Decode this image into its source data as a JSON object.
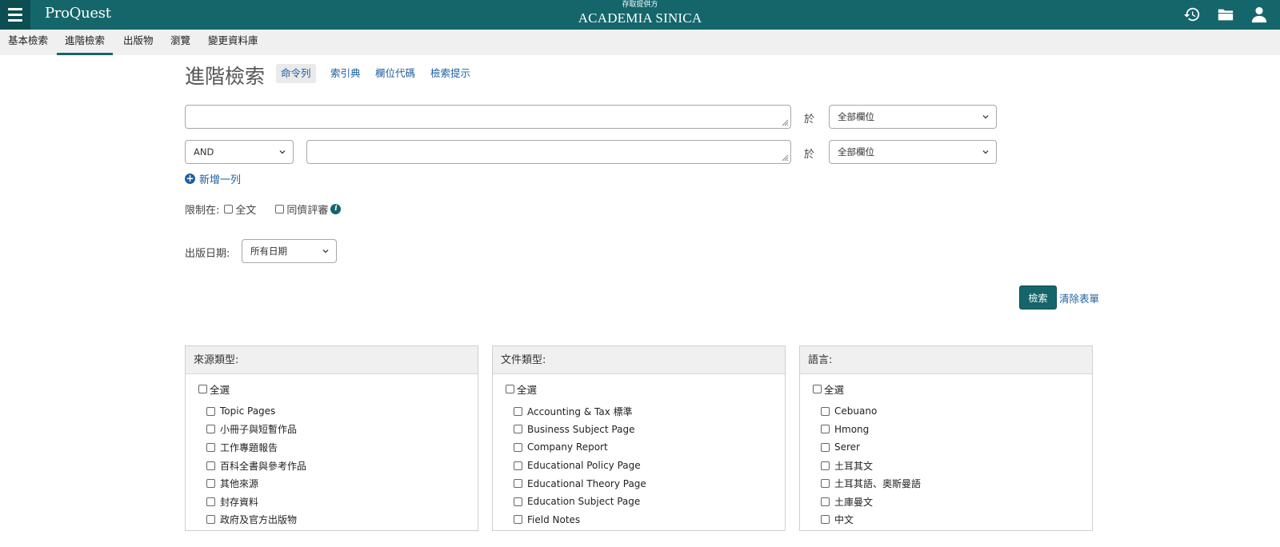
{
  "header": {
    "brand": "ProQuest",
    "provider_label": "存取提供方",
    "institution": "ACADEMIA SINICA",
    "icons": [
      "history-icon",
      "folder-icon",
      "user-icon"
    ],
    "bg_color": "#14666b"
  },
  "nav": {
    "tabs": [
      {
        "label": "基本檢索",
        "active": false
      },
      {
        "label": "進階檢索",
        "active": true
      },
      {
        "label": "出版物",
        "active": false
      },
      {
        "label": "瀏覽",
        "active": false
      },
      {
        "label": "變更資料庫",
        "active": false
      }
    ]
  },
  "title": {
    "text": "進階檢索",
    "links": [
      {
        "label": "命令列",
        "selected": true
      },
      {
        "label": "索引典",
        "selected": false
      },
      {
        "label": "欄位代碼",
        "selected": false
      },
      {
        "label": "檢索提示",
        "selected": false
      }
    ]
  },
  "search_rows": [
    {
      "operator": null,
      "value": "",
      "in_label": "於",
      "field": "全部欄位"
    },
    {
      "operator": "AND",
      "value": "",
      "in_label": "於",
      "field": "全部欄位"
    }
  ],
  "add_row_label": "新增一列",
  "limits": {
    "label": "限制在:",
    "options": [
      {
        "label": "全文",
        "checked": false
      },
      {
        "label": "同儕評審",
        "checked": false
      }
    ]
  },
  "date": {
    "label": "出版日期:",
    "value": "所有日期"
  },
  "actions": {
    "search_label": "檢索",
    "clear_label": "清除表單",
    "accent_color": "#14666b",
    "link_color": "#1d5f9e"
  },
  "panels": [
    {
      "title": "來源類型:",
      "select_all": "全選",
      "items": [
        "Topic Pages",
        "小冊子與短暫作品",
        "工作專題報告",
        "百科全書與參考作品",
        "其他來源",
        "封存資料",
        "政府及官方出版物"
      ]
    },
    {
      "title": "文件類型:",
      "select_all": "全選",
      "items": [
        "Accounting & Tax 標準",
        "Business Subject Page",
        "Company Report",
        "Educational Policy Page",
        "Educational Theory Page",
        "Education Subject Page",
        "Field Notes"
      ]
    },
    {
      "title": "語言:",
      "select_all": "全選",
      "items": [
        "Cebuano",
        "Hmong",
        "Serer",
        "土耳其文",
        "土耳其語、奧斯曼語",
        "土庫曼文",
        "中文"
      ]
    }
  ]
}
